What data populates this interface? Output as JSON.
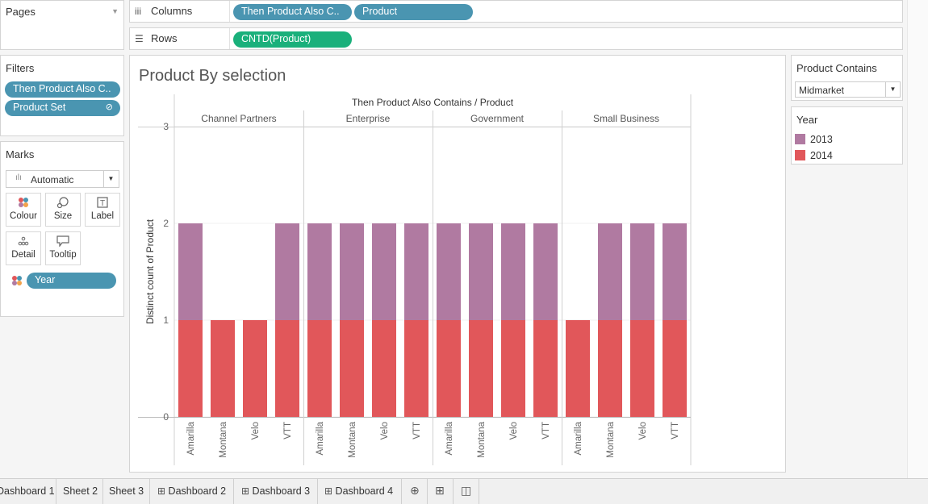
{
  "pages": {
    "title": "Pages"
  },
  "filters": {
    "title": "Filters",
    "items": [
      "Then Product Also C..",
      "Product Set"
    ]
  },
  "marks": {
    "title": "Marks",
    "type": "Automatic",
    "buttons": [
      "Colour",
      "Size",
      "Label",
      "Detail",
      "Tooltip"
    ],
    "color_field": "Year"
  },
  "shelves": {
    "columns_label": "Columns",
    "columns_pills": [
      "Then Product Also C..",
      "Product"
    ],
    "rows_label": "Rows",
    "rows_pills": [
      "CNTD(Product)"
    ]
  },
  "view": {
    "title": "Product By selection"
  },
  "chart_data": {
    "type": "bar",
    "title": "Product By selection",
    "header": "Then Product Also Contains / Product",
    "ylabel": "Distinct count of Product",
    "ylim": [
      0,
      3
    ],
    "yticks": [
      "0",
      "1",
      "2",
      "3"
    ],
    "stacked": true,
    "panes": [
      "Channel Partners",
      "Enterprise",
      "Government",
      "Small Business"
    ],
    "categories": [
      "Amarilla",
      "Montana",
      "Velo",
      "VTT"
    ],
    "series": [
      {
        "name": "2014",
        "color": "#e1575a",
        "values": [
          [
            1,
            1,
            1,
            1
          ],
          [
            1,
            1,
            1,
            1
          ],
          [
            1,
            1,
            1,
            1
          ],
          [
            1,
            1,
            1,
            1
          ]
        ]
      },
      {
        "name": "2013",
        "color": "#b07aa1",
        "values": [
          [
            1,
            0,
            0,
            1
          ],
          [
            1,
            1,
            1,
            1
          ],
          [
            1,
            1,
            1,
            1
          ],
          [
            0,
            1,
            1,
            1
          ]
        ]
      }
    ]
  },
  "parameter": {
    "title": "Product Contains",
    "value": "Midmarket"
  },
  "legend": {
    "title": "Year",
    "items": [
      {
        "label": "2013",
        "color": "#b07aa1"
      },
      {
        "label": "2014",
        "color": "#e1575a"
      }
    ]
  },
  "tabs": [
    "Dashboard 1",
    "Sheet 2",
    "Sheet 3",
    "Dashboard 2",
    "Dashboard 3",
    "Dashboard 4"
  ]
}
